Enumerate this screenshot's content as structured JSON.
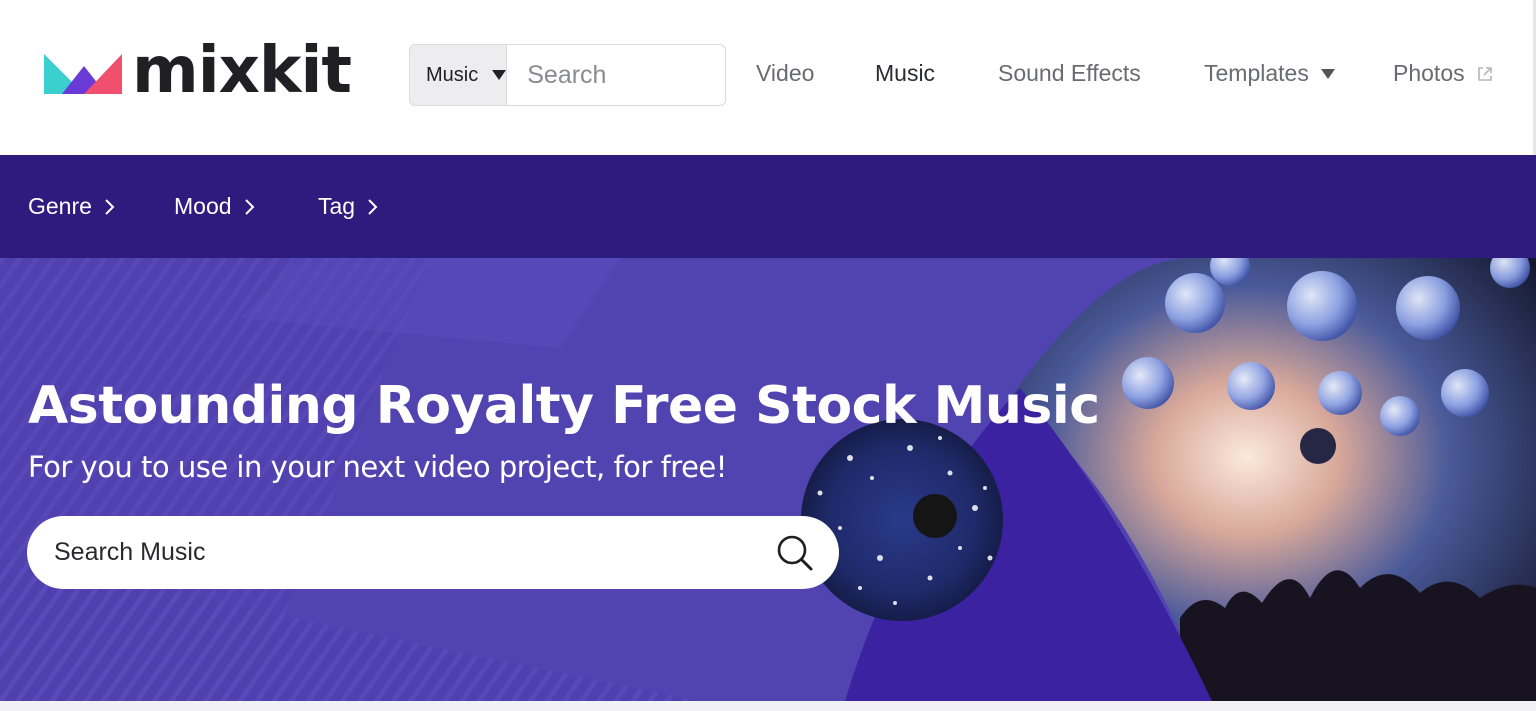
{
  "header": {
    "logo_text": "mixkit",
    "search": {
      "category_selected": "Music",
      "placeholder": "Search"
    },
    "nav": [
      {
        "label": "Video",
        "active": false
      },
      {
        "label": "Music",
        "active": true
      },
      {
        "label": "Sound Effects",
        "active": false
      },
      {
        "label": "Templates",
        "active": false,
        "dropdown": true
      },
      {
        "label": "Photos",
        "active": false,
        "external": true
      }
    ]
  },
  "category_bar": {
    "items": [
      {
        "label": "Genre"
      },
      {
        "label": "Mood"
      },
      {
        "label": "Tag"
      }
    ]
  },
  "hero": {
    "title": "Astounding Royalty Free Stock Music",
    "subtitle": "For you to use in your next video project, for free!",
    "search_placeholder": "Search Music"
  },
  "colors": {
    "category_bar_bg": "#2d1b7e",
    "hero_bg": "#5244b0",
    "logo_teal": "#3ccfcf",
    "logo_purple": "#6a3bd6",
    "logo_pink": "#f0506e"
  },
  "icons": [
    "mixkit-logo-mark",
    "chevron-down-icon",
    "search-icon",
    "external-link-icon",
    "chevron-right-icon"
  ]
}
